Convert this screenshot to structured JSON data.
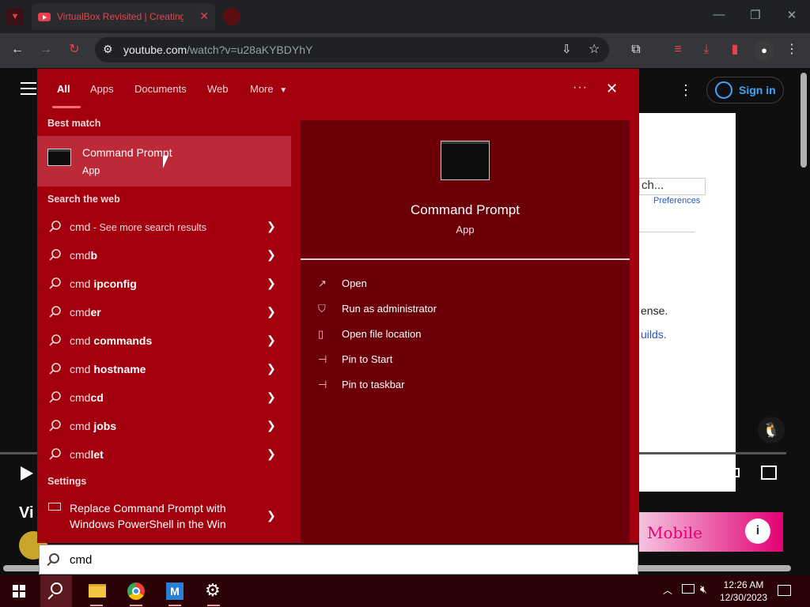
{
  "browser": {
    "tab_title": "VirtualBox Revisited | Creating",
    "url_host": "youtube.com",
    "url_path": "/watch?v=u28aKYBDYhY"
  },
  "youtube": {
    "sign_in": "Sign in",
    "video_search_fragment": "ch...",
    "video_preferences": "Preferences",
    "video_text_1": "ense.",
    "video_text_2": "uilds.",
    "title_fragment": "Vi",
    "ad_text": "Mobile"
  },
  "search": {
    "tabs": [
      "All",
      "Apps",
      "Documents",
      "Web",
      "More"
    ],
    "more_options": "···",
    "best_match_heading": "Best match",
    "best_match": {
      "title": "Command Prompt",
      "subtitle": "App"
    },
    "search_web_heading": "Search the web",
    "web_results": [
      {
        "prefix": "cmd",
        "bold": "",
        "suffix": " - See more search results"
      },
      {
        "prefix": "cmd",
        "bold": "b",
        "suffix": ""
      },
      {
        "prefix": "cmd",
        "bold": " ipconfig",
        "suffix": ""
      },
      {
        "prefix": "cmd",
        "bold": "er",
        "suffix": ""
      },
      {
        "prefix": "cmd",
        "bold": " commands",
        "suffix": ""
      },
      {
        "prefix": "cmd",
        "bold": " hostname",
        "suffix": ""
      },
      {
        "prefix": "cmd",
        "bold": "cd",
        "suffix": ""
      },
      {
        "prefix": "cmd",
        "bold": " jobs",
        "suffix": ""
      },
      {
        "prefix": "cmd",
        "bold": "let",
        "suffix": ""
      }
    ],
    "settings_heading": "Settings",
    "settings_item": {
      "line1": "Replace Command Prompt with",
      "line2": "Windows PowerShell in the Win"
    },
    "preview": {
      "title": "Command Prompt",
      "subtitle": "App"
    },
    "actions": [
      "Open",
      "Run as administrator",
      "Open file location",
      "Pin to Start",
      "Pin to taskbar"
    ],
    "query": "cmd"
  },
  "taskbar": {
    "time": "12:26 AM",
    "date": "12/30/2023"
  },
  "colors": {
    "panel": "#a3000e",
    "preview": "#6b0008",
    "highlight": "#bc2a37",
    "accent": "#3ea6ff"
  }
}
